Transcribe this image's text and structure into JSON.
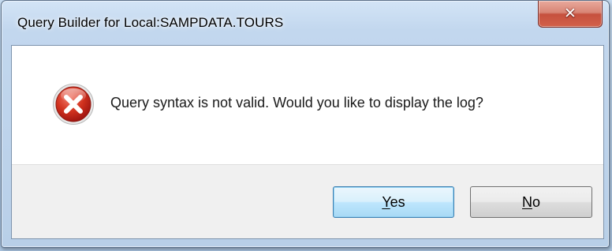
{
  "dialog": {
    "title": "Query Builder for Local:SAMPDATA.TOURS",
    "close_glyph": "✕",
    "icon": "error-icon",
    "message": "Query syntax is not valid. Would you like to display the log?",
    "buttons": {
      "yes": {
        "accel": "Y",
        "rest": "es"
      },
      "no": {
        "accel": "N",
        "rest": "o"
      }
    }
  },
  "colors": {
    "error_red": "#c8261c",
    "close_button": "#c6503e",
    "default_button_border": "#3c7fb1"
  }
}
